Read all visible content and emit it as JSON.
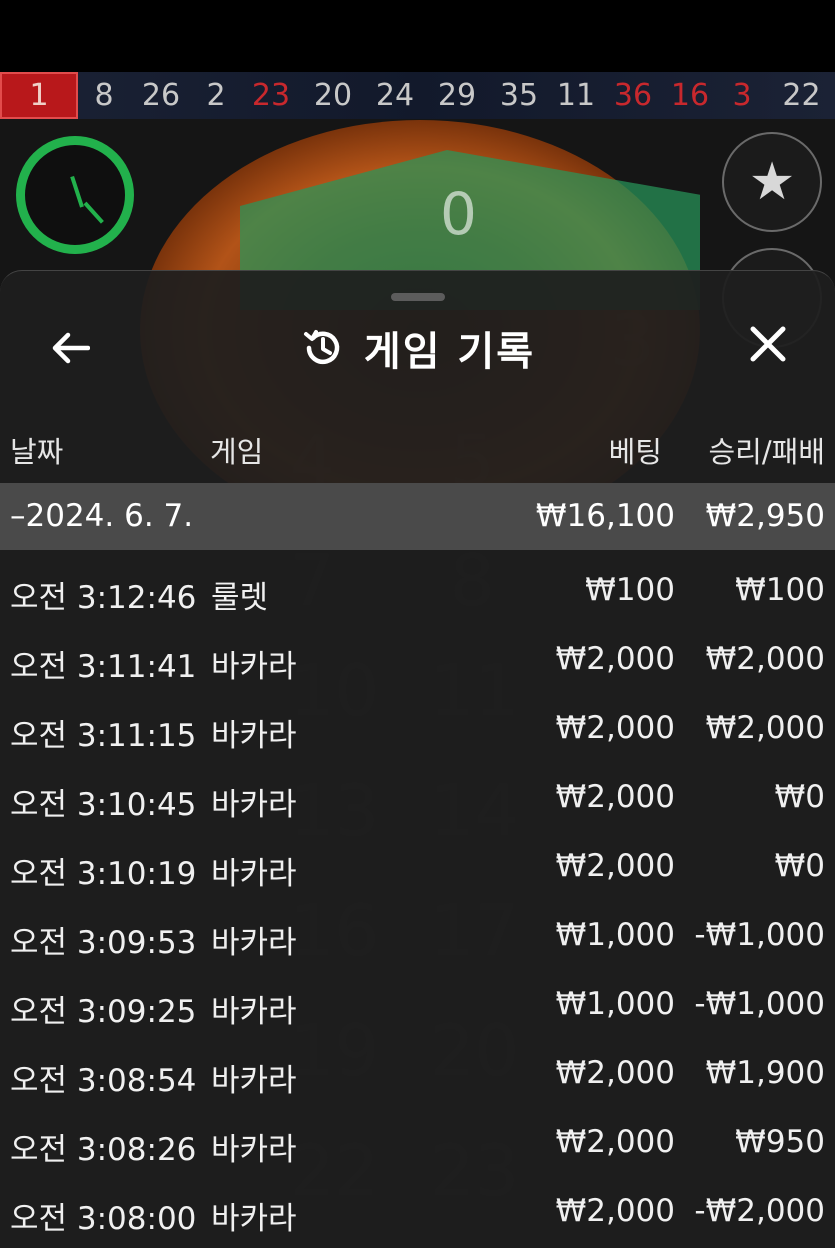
{
  "recent_numbers": [
    {
      "n": "1",
      "color": "latest"
    },
    {
      "n": "8",
      "color": "black"
    },
    {
      "n": "26",
      "color": "black"
    },
    {
      "n": "2",
      "color": "black"
    },
    {
      "n": "23",
      "color": "red"
    },
    {
      "n": "20",
      "color": "black"
    },
    {
      "n": "24",
      "color": "black"
    },
    {
      "n": "29",
      "color": "black"
    },
    {
      "n": "35",
      "color": "black"
    },
    {
      "n": "11",
      "color": "black"
    },
    {
      "n": "36",
      "color": "red"
    },
    {
      "n": "16",
      "color": "red"
    },
    {
      "n": "3",
      "color": "red"
    },
    {
      "n": "22",
      "color": "black"
    }
  ],
  "game": {
    "wheel_result": "0",
    "accent_color": "#22b14c"
  },
  "panel": {
    "title": "게임 기록",
    "back_icon": "arrow-left-icon",
    "close_icon": "close-icon",
    "history_icon": "history-icon"
  },
  "columns": {
    "date": "날짜",
    "game": "게임",
    "bet": "베팅",
    "winloss": "승리/패배"
  },
  "day_summary": {
    "date": "–2024. 6. 7.",
    "bet": "₩16,100",
    "winloss": "₩2,950"
  },
  "rows": [
    {
      "time": "오전 3:12:46",
      "game": "룰렛",
      "bet": "₩100",
      "winloss": "₩100"
    },
    {
      "time": "오전 3:11:41",
      "game": "바카라",
      "bet": "₩2,000",
      "winloss": "₩2,000"
    },
    {
      "time": "오전 3:11:15",
      "game": "바카라",
      "bet": "₩2,000",
      "winloss": "₩2,000"
    },
    {
      "time": "오전 3:10:45",
      "game": "바카라",
      "bet": "₩2,000",
      "winloss": "₩0"
    },
    {
      "time": "오전 3:10:19",
      "game": "바카라",
      "bet": "₩2,000",
      "winloss": "₩0"
    },
    {
      "time": "오전 3:09:53",
      "game": "바카라",
      "bet": "₩1,000",
      "winloss": "-₩1,000"
    },
    {
      "time": "오전 3:09:25",
      "game": "바카라",
      "bet": "₩1,000",
      "winloss": "-₩1,000"
    },
    {
      "time": "오전 3:08:54",
      "game": "바카라",
      "bet": "₩2,000",
      "winloss": "₩1,900"
    },
    {
      "time": "오전 3:08:26",
      "game": "바카라",
      "bet": "₩2,000",
      "winloss": "₩950"
    },
    {
      "time": "오전 3:08:00",
      "game": "바카라",
      "bet": "₩2,000",
      "winloss": "-₩2,000"
    }
  ]
}
